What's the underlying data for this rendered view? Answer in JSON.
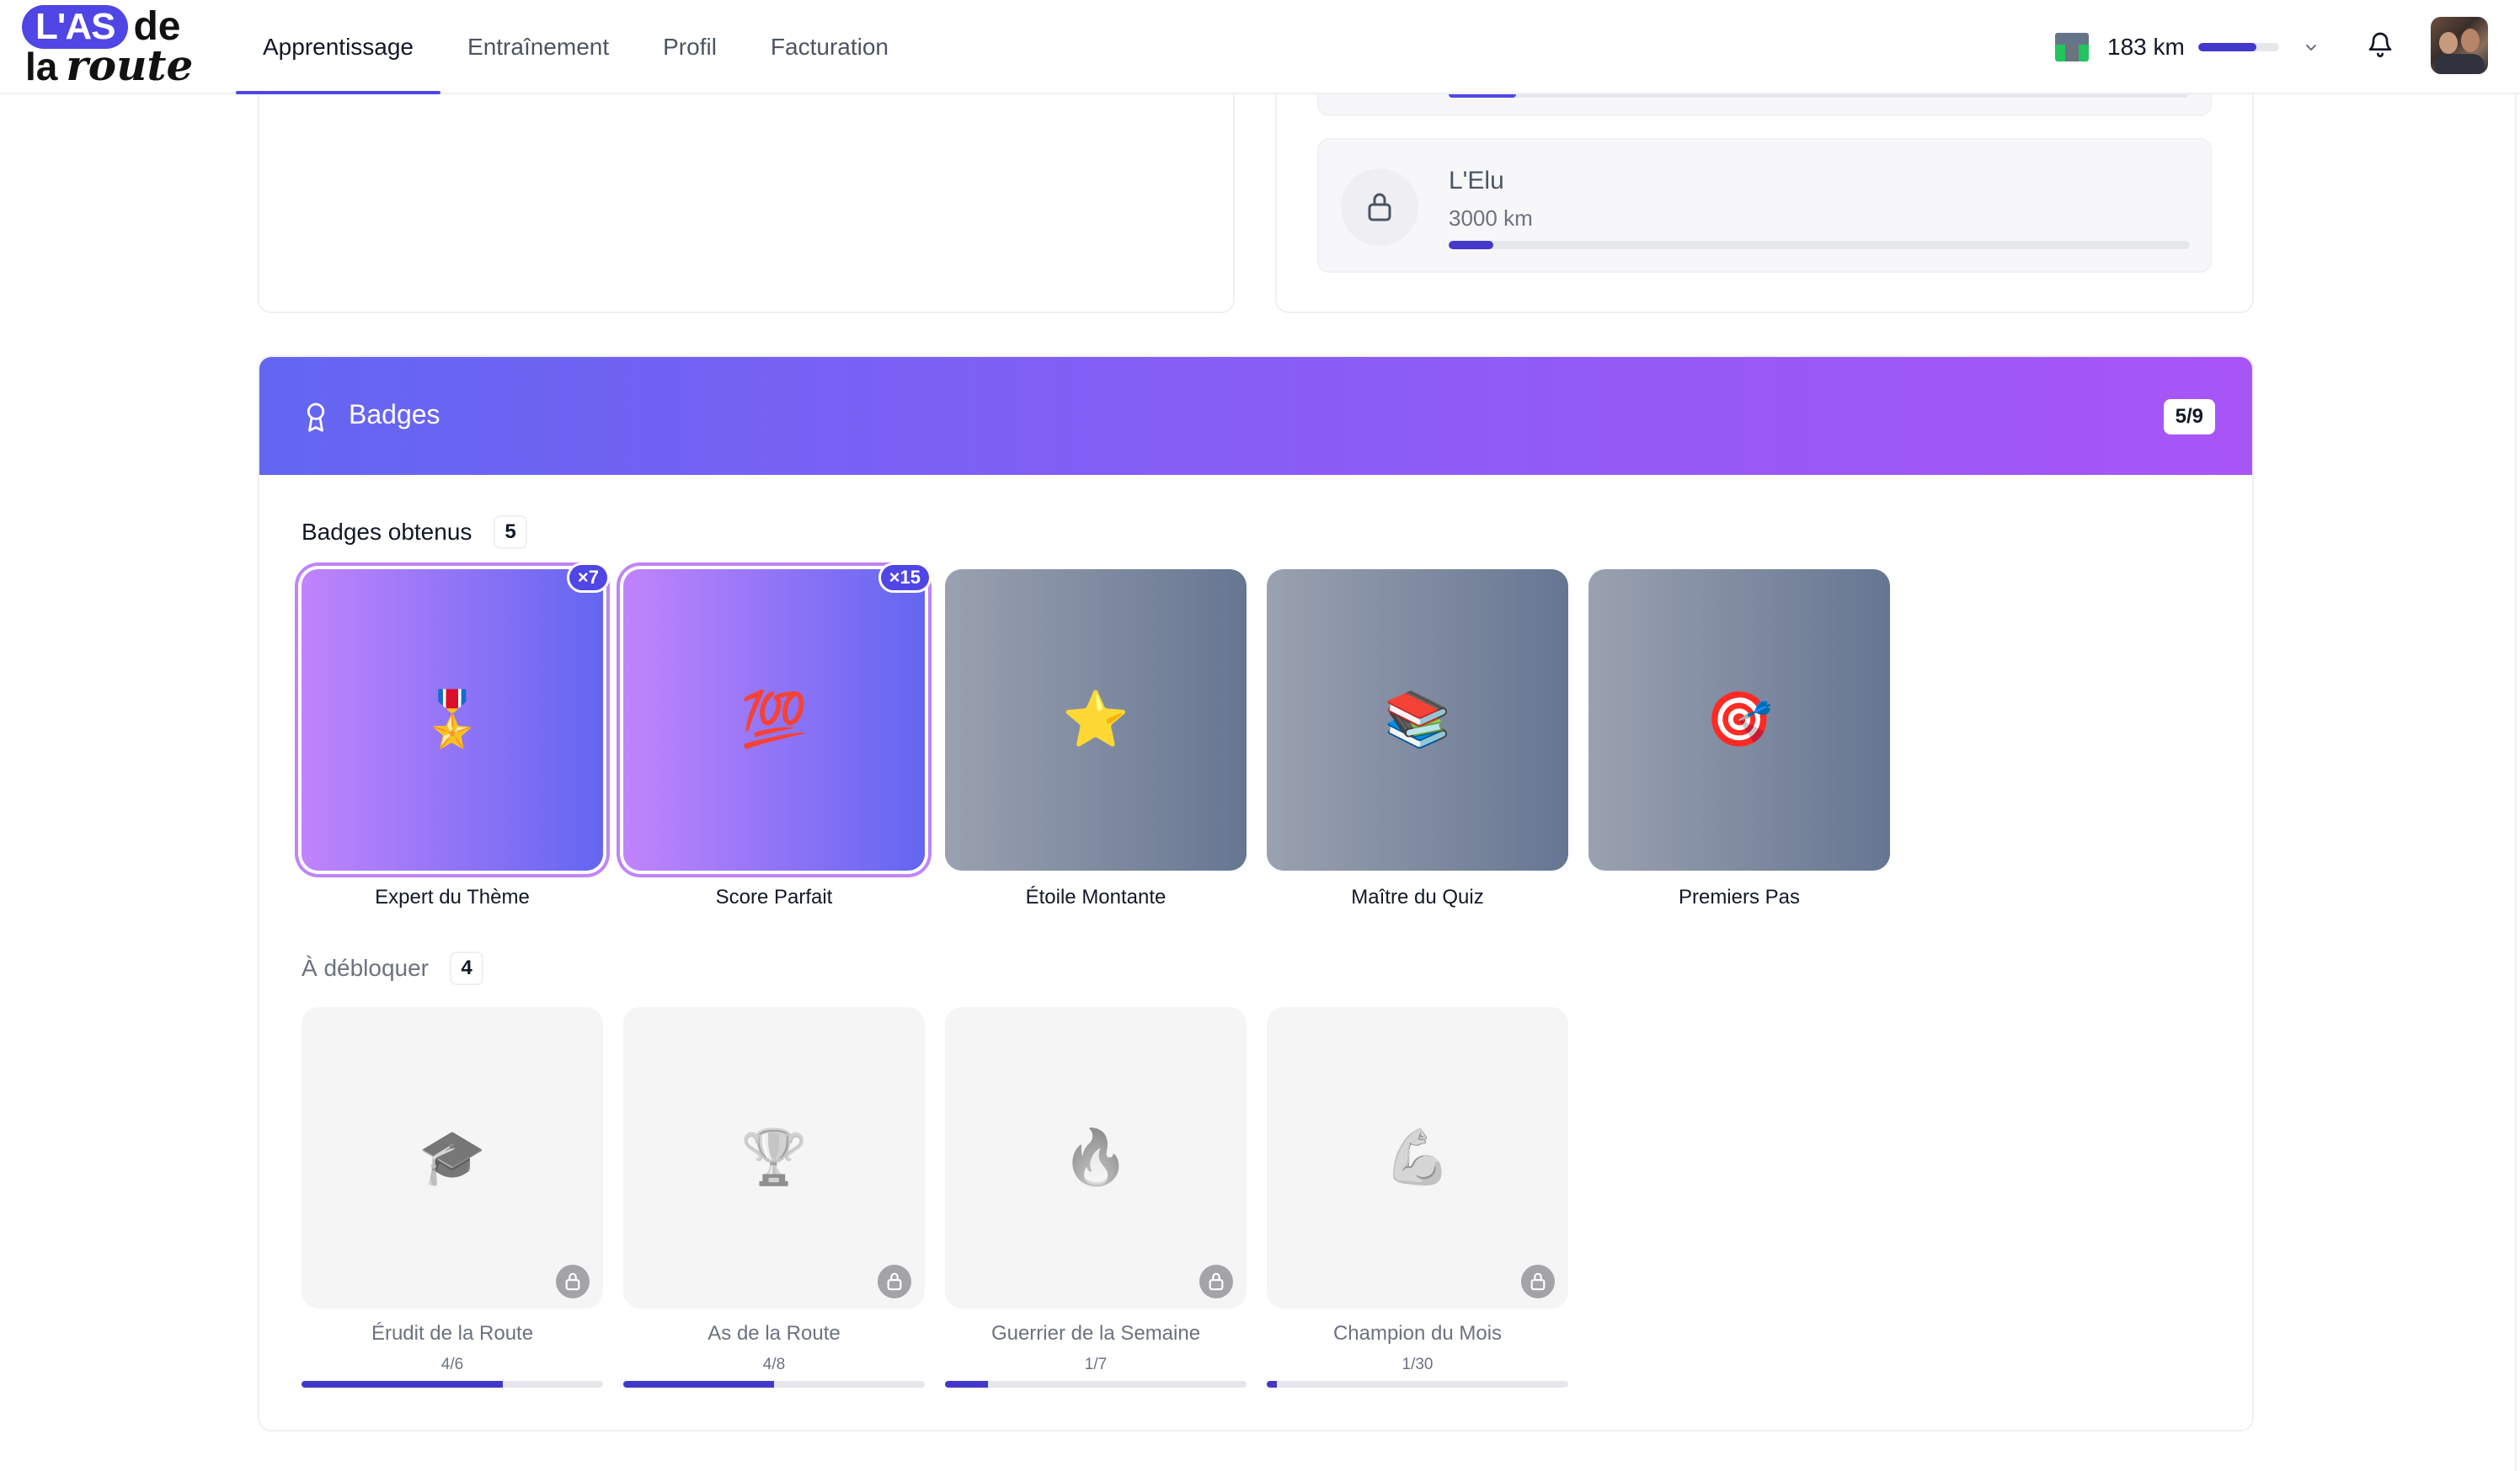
{
  "app": {
    "logo": {
      "part1": "L'AS",
      "part2": "de",
      "part3": "la",
      "part4": "route"
    },
    "nav": [
      {
        "label": "Apprentissage",
        "active": true
      },
      {
        "label": "Entraînement",
        "active": false
      },
      {
        "label": "Profil",
        "active": false
      },
      {
        "label": "Facturation",
        "active": false
      }
    ],
    "distance": {
      "label": "183 km",
      "progress": 0.72
    },
    "icons": {
      "distance": "road-icon",
      "dropdown": "chevron-down-icon",
      "notifications": "bell-icon",
      "user": "avatar"
    }
  },
  "levels": {
    "current": {
      "name": "L'Elu",
      "distance": "3000 km",
      "progress": 0.06,
      "locked": true
    }
  },
  "badges": {
    "title": "Badges",
    "count": "5/9",
    "earned": {
      "label": "Badges obtenus",
      "count": "5",
      "items": [
        {
          "name": "Expert du Thème",
          "emoji": "🎖️",
          "multiplier": "×7",
          "style": "purple"
        },
        {
          "name": "Score Parfait",
          "emoji": "💯",
          "multiplier": "×15",
          "style": "purple"
        },
        {
          "name": "Étoile Montante",
          "emoji": "⭐",
          "multiplier": "",
          "style": "gray"
        },
        {
          "name": "Maître du Quiz",
          "emoji": "📚",
          "multiplier": "",
          "style": "gray"
        },
        {
          "name": "Premiers Pas",
          "emoji": "🎯",
          "multiplier": "",
          "style": "gray"
        }
      ]
    },
    "locked": {
      "label": "À débloquer",
      "count": "4",
      "items": [
        {
          "name": "Érudit de la Route",
          "emoji": "🎓",
          "progress": "4/6",
          "ratio": 0.667
        },
        {
          "name": "As de la Route",
          "emoji": "🏆",
          "progress": "4/8",
          "ratio": 0.5
        },
        {
          "name": "Guerrier de la Semaine",
          "emoji": "🔥",
          "progress": "1/7",
          "ratio": 0.143
        },
        {
          "name": "Champion du Mois",
          "emoji": "💪",
          "progress": "1/30",
          "ratio": 0.033
        }
      ]
    }
  }
}
